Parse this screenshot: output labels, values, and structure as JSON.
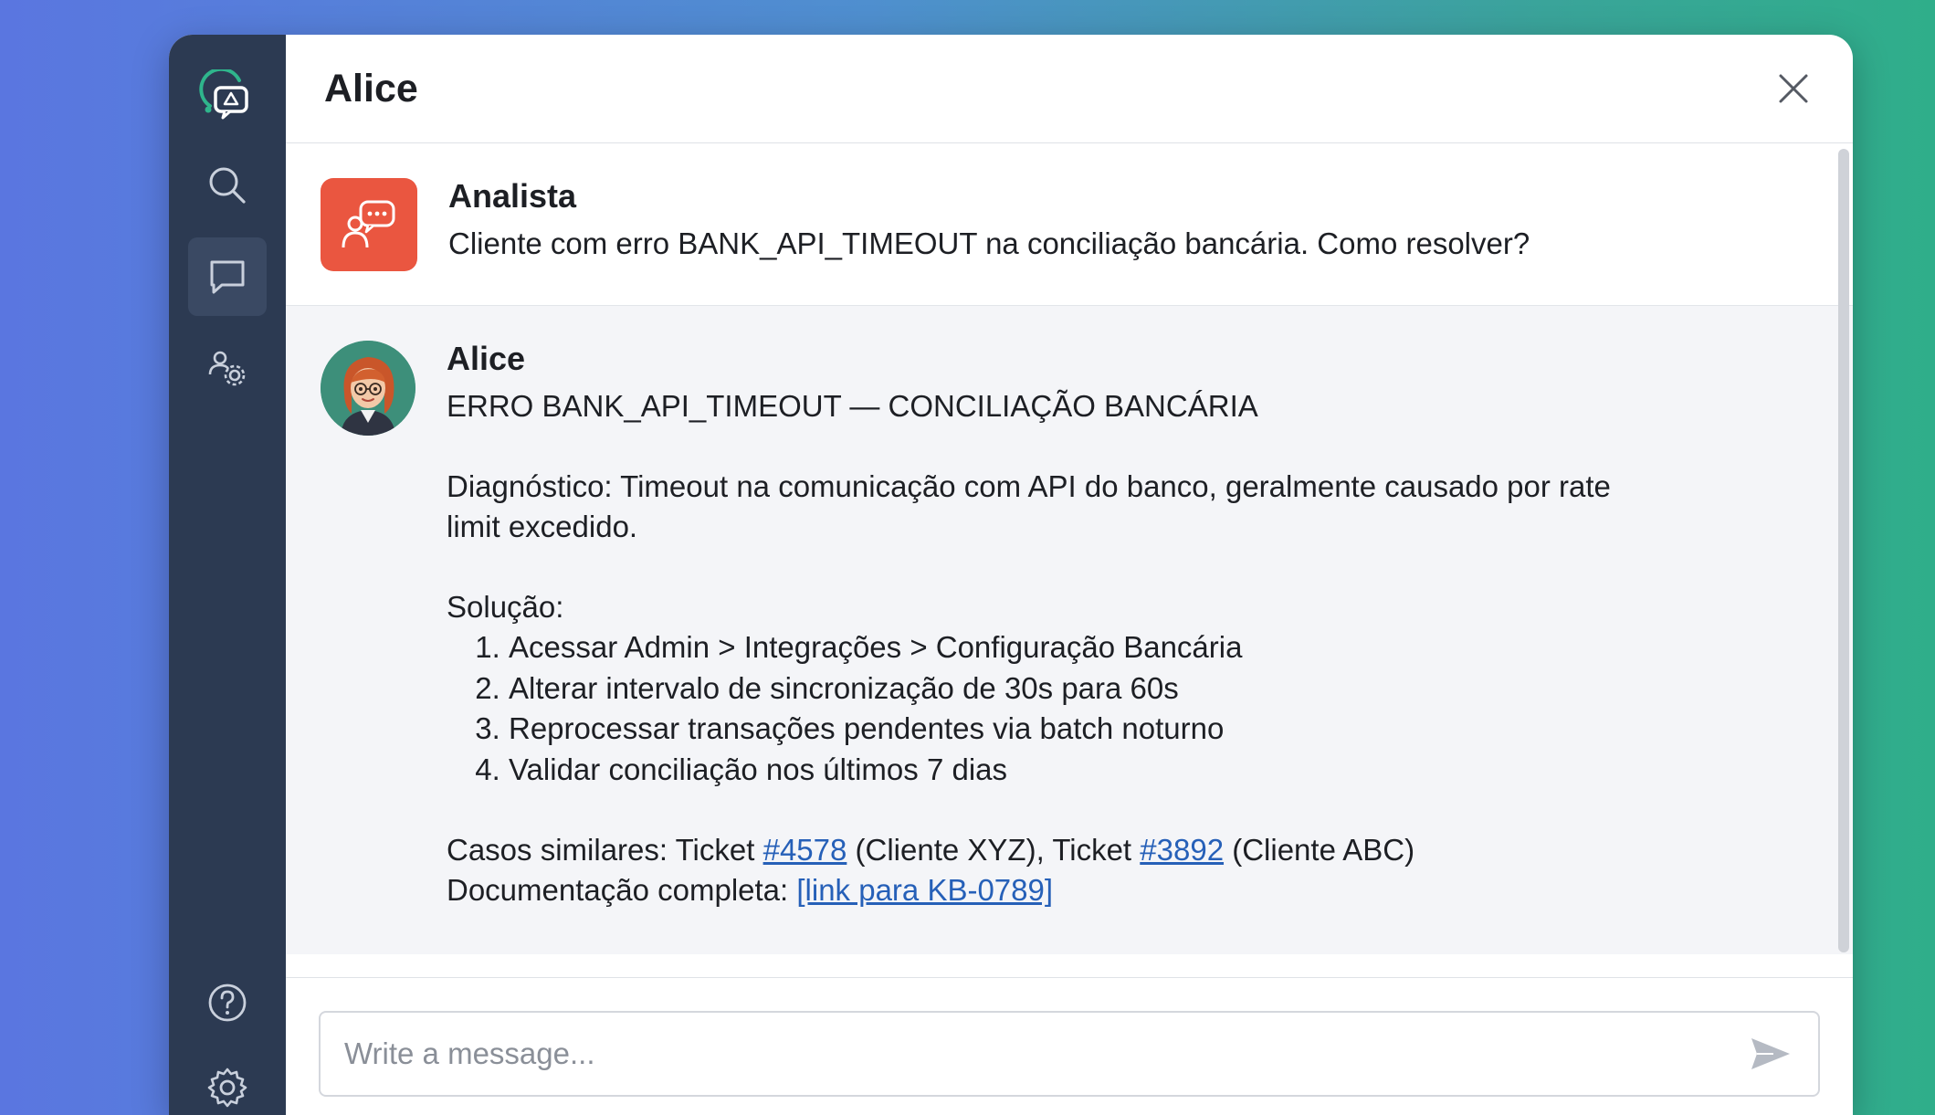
{
  "header": {
    "title": "Alice"
  },
  "sidebar": {
    "icons": [
      "app-logo-icon",
      "search-icon",
      "chat-icon",
      "users-settings-icon",
      "help-icon",
      "settings-icon"
    ],
    "active": "chat-icon"
  },
  "conversation": {
    "user_message": {
      "sender": "Analista",
      "text": "Cliente com erro BANK_API_TIMEOUT na conciliação bancária. Como resolver?"
    },
    "bot_message": {
      "sender": "Alice",
      "heading": "ERRO BANK_API_TIMEOUT — CONCILIAÇÃO BANCÁRIA",
      "diagnosis": "Diagnóstico: Timeout na comunicação com API do banco, geralmente causado por rate limit excedido.",
      "solution_label": "Solução:",
      "steps": [
        "Acessar Admin > Integrações > Configuração Bancária",
        "Alterar intervalo de sincronização de 30s para 60s",
        "Reprocessar transações pendentes via batch noturno",
        "Validar conciliação nos últimos 7 dias"
      ],
      "similar_prefix": "Casos similares: Ticket ",
      "ticket1": "#4578",
      "ticket1_suffix": " (Cliente XYZ), Ticket ",
      "ticket2": "#3892",
      "ticket2_suffix": " (Cliente ABC)",
      "docs_prefix": "Documentação completa: ",
      "docs_link": "[link para KB-0789]"
    }
  },
  "composer": {
    "placeholder": "Write a message..."
  },
  "colors": {
    "sidebar_bg": "#2c3a52",
    "user_avatar_bg": "#ea5640",
    "link": "#2660b8",
    "accent_green": "#2fae8a"
  }
}
